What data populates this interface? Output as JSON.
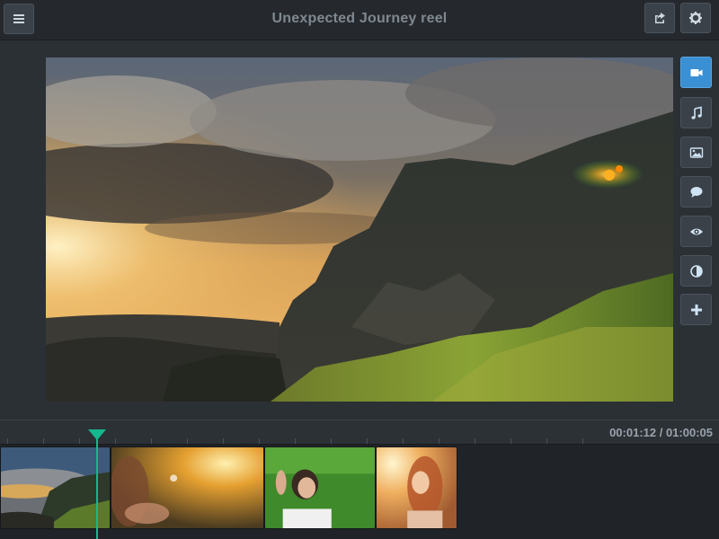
{
  "header": {
    "title": "Unexpected Journey reel",
    "menu_icon": "menu-icon",
    "share_icon": "share-icon",
    "settings_icon": "gear-icon"
  },
  "sidebar": {
    "items": [
      {
        "icon": "video-camera-icon",
        "active": true
      },
      {
        "icon": "music-note-icon",
        "active": false
      },
      {
        "icon": "image-icon",
        "active": false
      },
      {
        "icon": "speech-bubble-icon",
        "active": false
      },
      {
        "icon": "eye-icon",
        "active": false
      },
      {
        "icon": "contrast-icon",
        "active": false
      },
      {
        "icon": "plus-icon",
        "active": false
      }
    ]
  },
  "timeline": {
    "current_time": "00:01:12",
    "total_time": "01:00:05",
    "timecode": "00:01:12 / 01:00:05",
    "clips": [
      {
        "label": "mountain-clip"
      },
      {
        "label": "sunlight-clip"
      },
      {
        "label": "grass-woman-clip"
      },
      {
        "label": "sunset-portrait-clip"
      }
    ]
  },
  "colors": {
    "accent": "#3b8fd3",
    "playhead": "#14b88c",
    "background": "#2a2e33"
  }
}
